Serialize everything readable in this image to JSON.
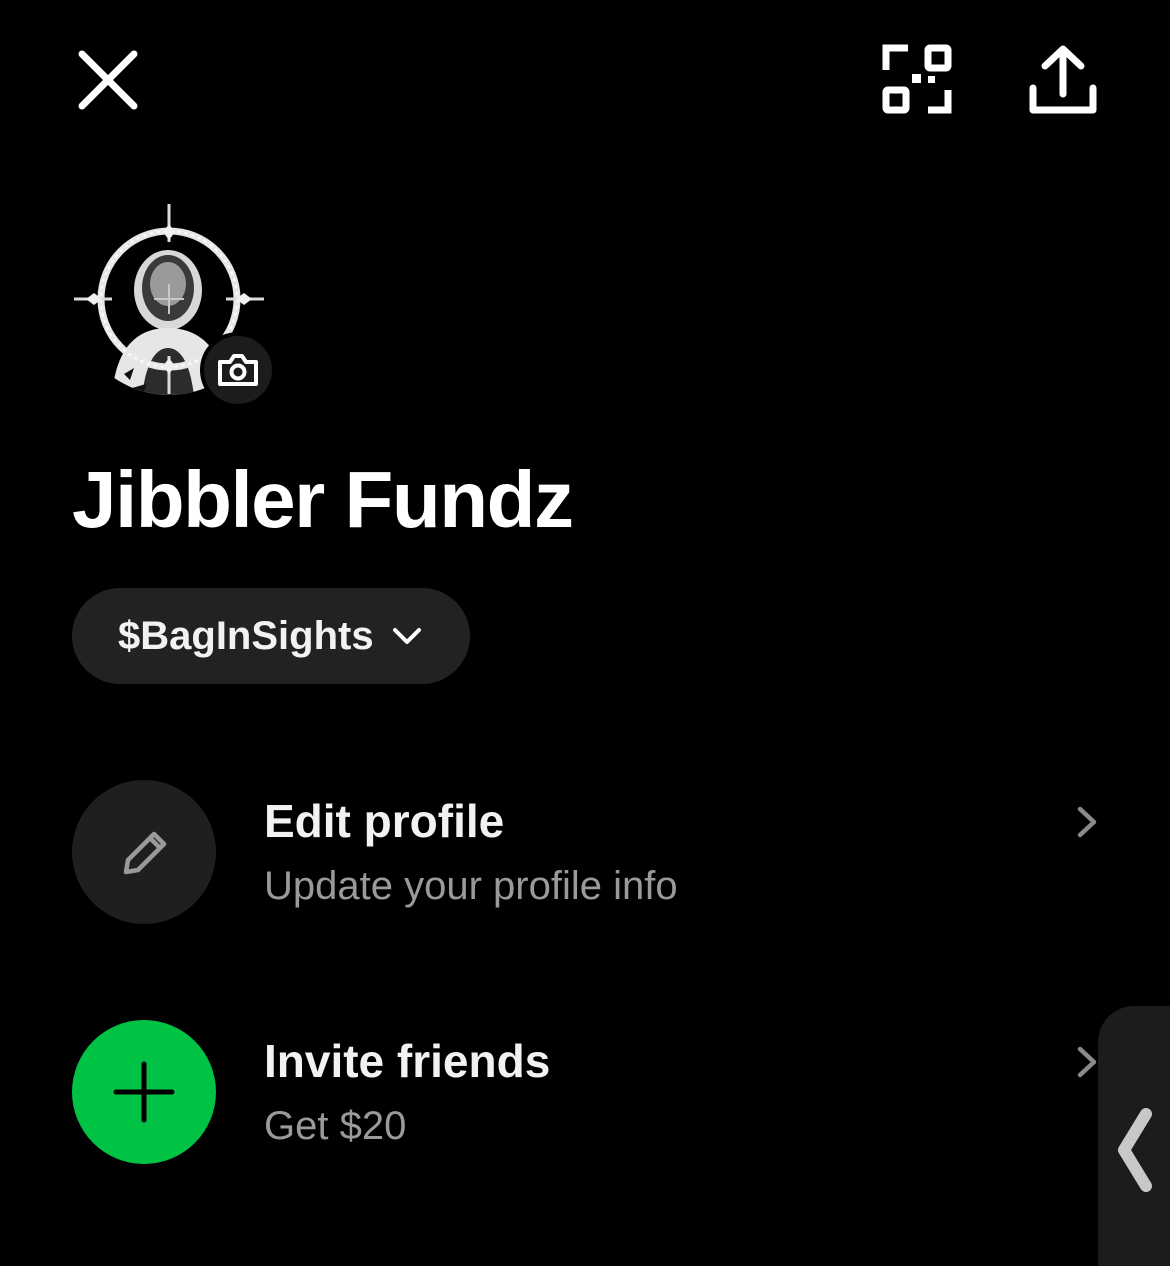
{
  "topbar": {
    "close_icon": "close-icon",
    "qr_icon": "qr-code-scan-icon",
    "share_icon": "share-upload-icon"
  },
  "profile": {
    "display_name": "Jibbler Fundz",
    "cashtag": "$BagInSights",
    "avatar_icon": "crosshair-avatar-image",
    "camera_icon": "camera-icon"
  },
  "menu": {
    "edit_profile": {
      "title": "Edit profile",
      "subtitle": "Update your profile info",
      "icon": "pencil-icon"
    },
    "invite_friends": {
      "title": "Invite friends",
      "subtitle": "Get $20",
      "icon": "plus-icon"
    }
  },
  "colors": {
    "background": "#000000",
    "surface": "#222222",
    "accent_green": "#00c244",
    "text_primary": "#f2f2f2",
    "text_secondary": "#9a9a9a"
  }
}
